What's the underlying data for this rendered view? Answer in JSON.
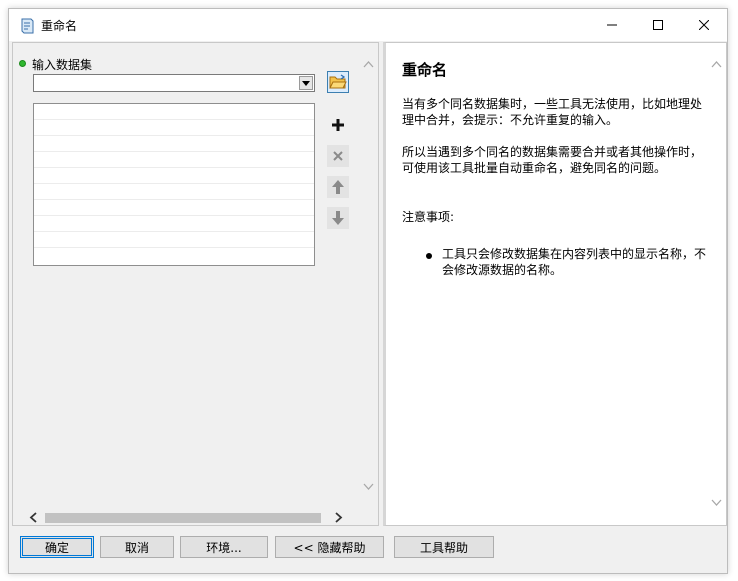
{
  "window": {
    "title": "重命名",
    "icon": "script-tool-icon",
    "controls": [
      "minimize-icon",
      "maximize-icon",
      "close-icon"
    ]
  },
  "parameters": {
    "input_label": "输入数据集",
    "combo_value": "",
    "list_items": [],
    "buttons": [
      "folder-open-icon",
      "plus-icon",
      "x-icon",
      "arrow-up-icon",
      "arrow-down-icon"
    ]
  },
  "help": {
    "title": "重命名",
    "p1": "当有多个同名数据集时，一些工具无法使用，比如地理处理中合并，会提示：不允许重复的输入。",
    "p2": "所以当遇到多个同名的数据集需要合并或者其他操作时，可使用该工具批量自动重命名，避免同名的问题。",
    "p3": "注意事项:",
    "bullet": "工具只会修改数据集在内容列表中的显示名称，不会修改源数据的名称。"
  },
  "footer": {
    "ok": "确定",
    "cancel": "取消",
    "env": "环境...",
    "hide_help": "<< 隐藏帮助",
    "tool_help": "工具帮助"
  },
  "colors": {
    "accent": "#0078d7",
    "required_dot": "#2fb72f",
    "folder_icon": "#e8a82a"
  }
}
